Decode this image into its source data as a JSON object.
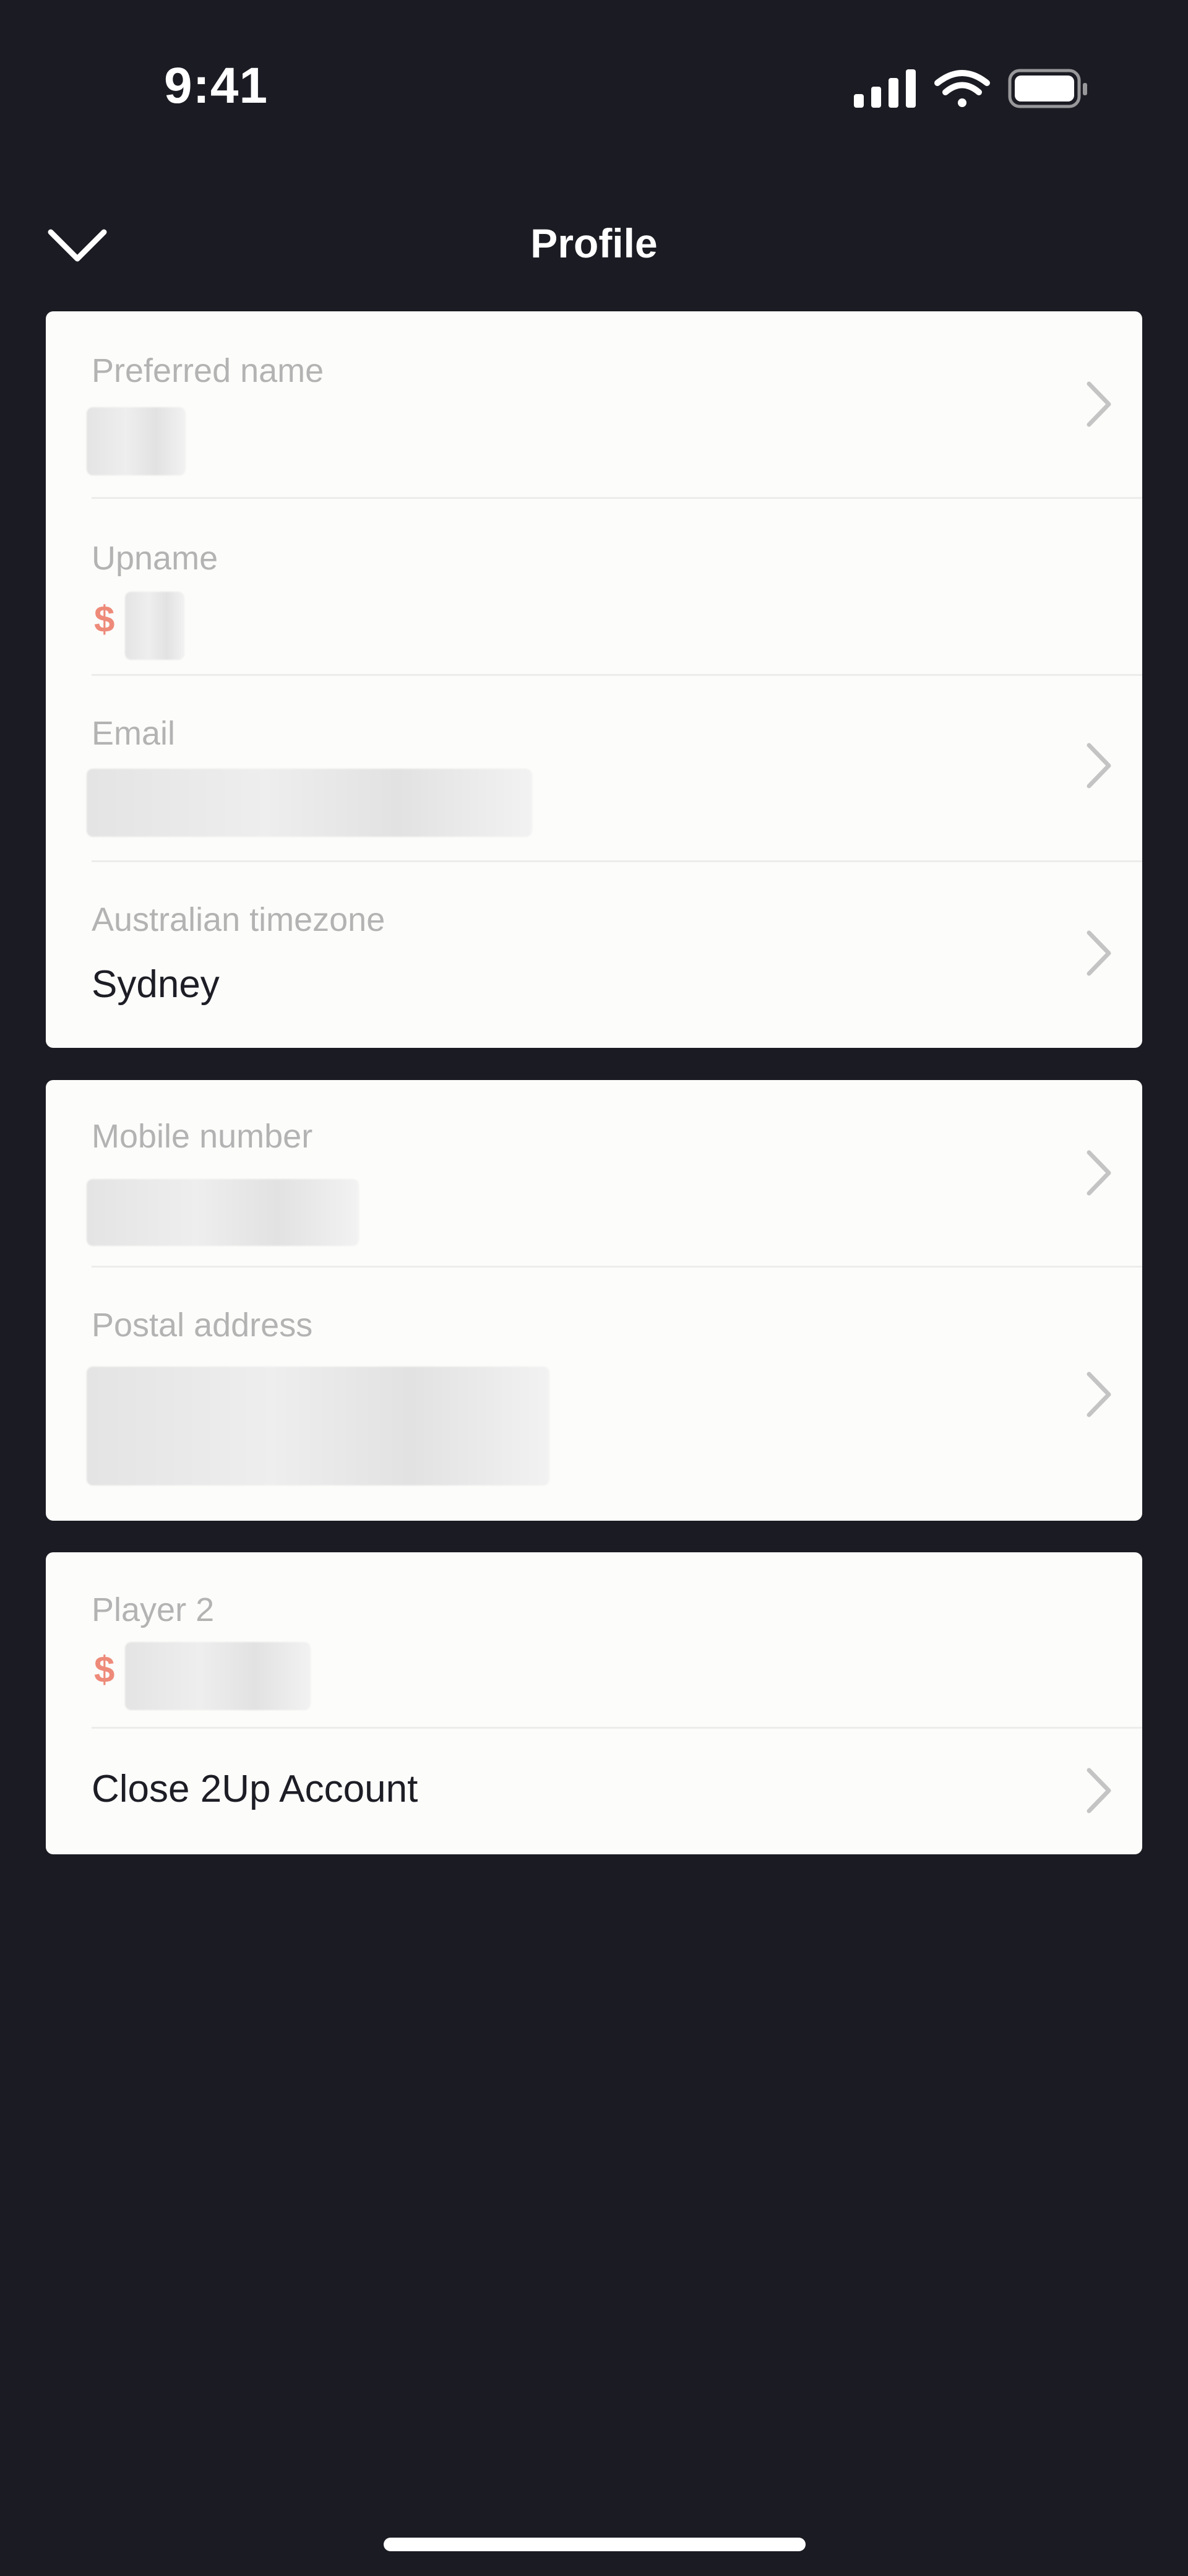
{
  "status_bar": {
    "time": "9:41",
    "icons": [
      "signal-icon",
      "wifi-icon",
      "battery-icon"
    ]
  },
  "header": {
    "title": "Profile",
    "back_icon": "chevron-down-icon"
  },
  "sections": {
    "personal": {
      "preferred_name": {
        "label": "Preferred name",
        "value_redacted": true
      },
      "upname": {
        "label": "Upname",
        "prefix": "$",
        "value_redacted": true
      },
      "email": {
        "label": "Email",
        "value_redacted": true
      },
      "timezone": {
        "label": "Australian timezone",
        "value": "Sydney"
      }
    },
    "contact": {
      "mobile": {
        "label": "Mobile number",
        "value_redacted": true
      },
      "postal": {
        "label": "Postal address",
        "value_redacted": true
      }
    },
    "account": {
      "player2": {
        "label": "Player 2",
        "prefix": "$",
        "value_redacted": true
      },
      "close": {
        "label": "Close 2Up Account"
      }
    }
  },
  "colors": {
    "background": "#1b1b23",
    "card": "#fcfcfa",
    "label": "#b3b3b3",
    "text": "#1d1d26",
    "accent": "#ee8a79"
  }
}
